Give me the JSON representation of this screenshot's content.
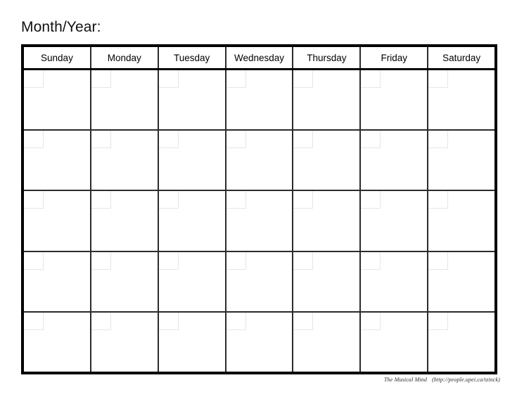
{
  "page": {
    "title_label": "Month/Year:",
    "background_color": "#ffffff",
    "border_color": "#000000",
    "grid_line_color": "#2b2b2b",
    "date_box_color": "#e6e6e6"
  },
  "calendar": {
    "weekday_headers": [
      "Sunday",
      "Monday",
      "Tuesday",
      "Wednesday",
      "Thursday",
      "Friday",
      "Saturday"
    ],
    "week_rows": 5,
    "columns": 7,
    "cells_are_blank": true,
    "day_numbers": [
      [
        "",
        "",
        "",
        "",
        "",
        "",
        ""
      ],
      [
        "",
        "",
        "",
        "",
        "",
        "",
        ""
      ],
      [
        "",
        "",
        "",
        "",
        "",
        "",
        ""
      ],
      [
        "",
        "",
        "",
        "",
        "",
        "",
        ""
      ],
      [
        "",
        "",
        "",
        "",
        "",
        "",
        ""
      ]
    ]
  },
  "footer": {
    "credit_name": "The Musical Mind",
    "credit_url": "(http://people.upei.ca/tzinck)"
  }
}
